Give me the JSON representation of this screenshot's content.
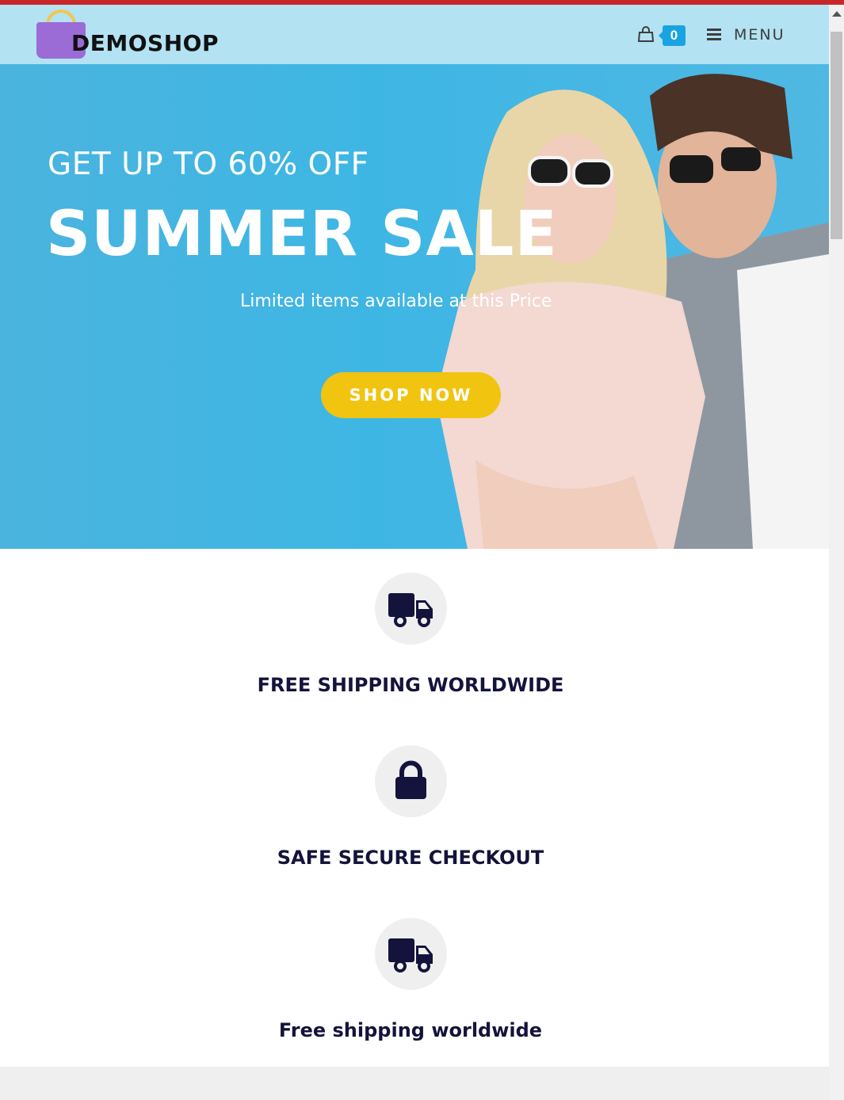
{
  "header": {
    "logo_text": "DEMOSHOP",
    "cart_count": "0",
    "menu_label": "MENU"
  },
  "hero": {
    "kicker": "GET UP TO 60% OFF",
    "title": "SUMMER SALE",
    "subtitle": "Limited items available at this Price",
    "cta_label": "SHOP NOW"
  },
  "features": [
    {
      "icon": "truck-icon",
      "title": "FREE SHIPPING WORLDWIDE"
    },
    {
      "icon": "lock-icon",
      "title": "SAFE SECURE CHECKOUT"
    },
    {
      "icon": "truck-icon",
      "title": "Free shipping worldwide"
    }
  ],
  "colors": {
    "header_bg": "#b3e2f3",
    "hero_bg": "#3eb6e4",
    "cta_bg": "#f1c40f",
    "badge_bg": "#19a4e1",
    "feature_text": "#14133b"
  }
}
